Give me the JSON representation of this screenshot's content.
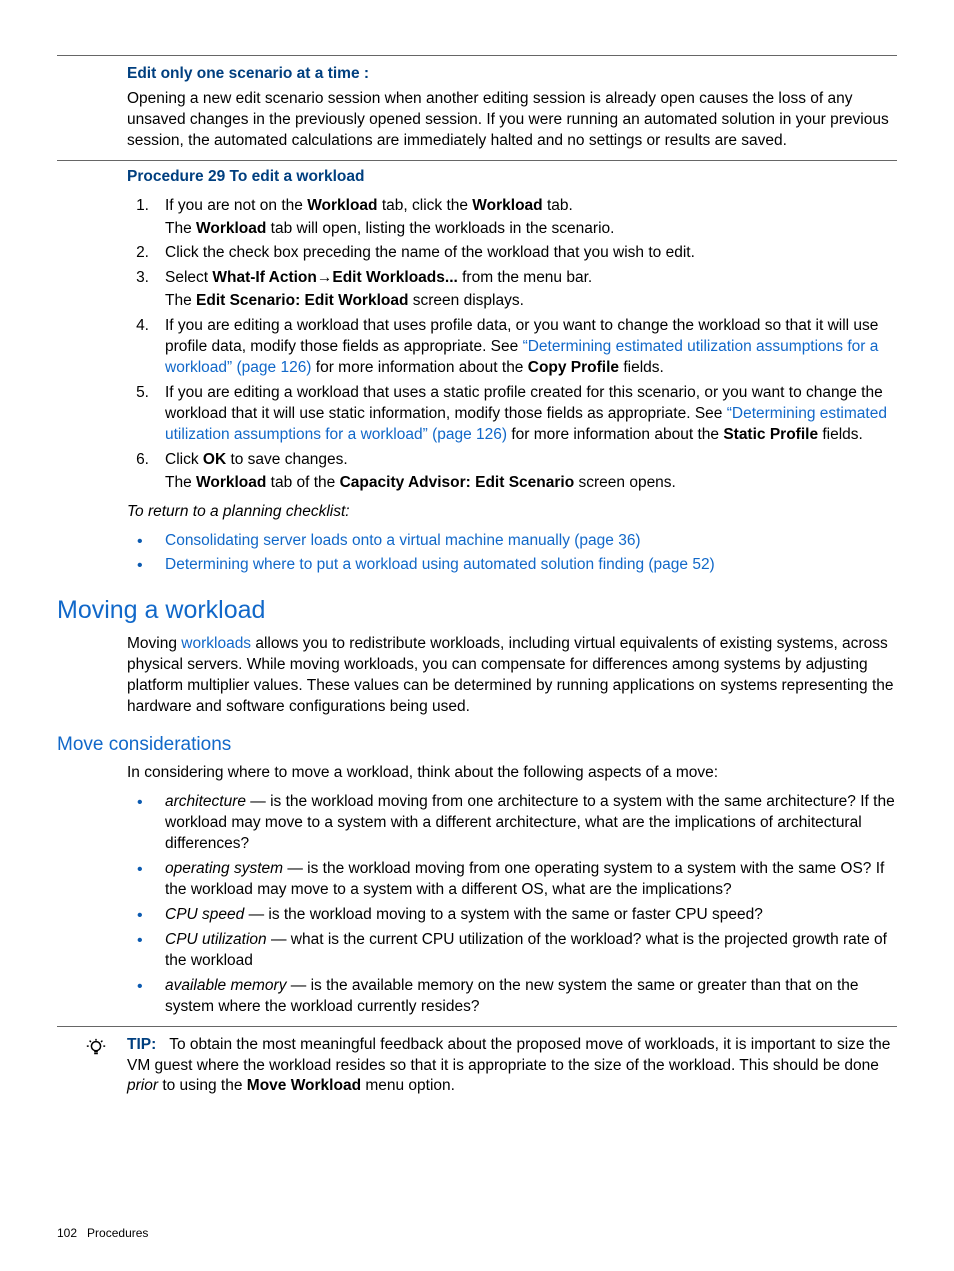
{
  "callout": {
    "title": "Edit only one scenario at a time :",
    "body": "Opening a new edit scenario session when another editing session is already open causes the loss of any unsaved changes in the previously opened session. If you were running an automated solution in your previous session, the automated calculations are immediately halted and no settings or results are saved."
  },
  "procedure": {
    "title": "Procedure 29 To edit a workload",
    "step1_a": "If you are not on the ",
    "step1_b": " tab, click the ",
    "step1_c": " tab.",
    "step1_sub_a": "The ",
    "step1_sub_b": " tab will open, listing the workloads in the scenario.",
    "step2": "Click the check box preceding the name of the workload that you wish to edit.",
    "step3_a": "Select ",
    "step3_b": " from the menu bar.",
    "step3_sub_a": "The ",
    "step3_sub_b": " screen displays.",
    "step4_a": "If you are editing a workload that uses profile data, or you want to change the workload so that it will use profile data, modify those fields as appropriate. See ",
    "step4_link": "“Determining estimated utilization assumptions for a workload” (page 126)",
    "step4_b": " for more information about the ",
    "step4_c": " fields.",
    "step5_a": "If you are editing a workload that uses a static profile created for this scenario, or you want to change the workload that it will use static information, modify those fields as appropriate. See ",
    "step5_link": "“Determining estimated utilization assumptions for a workload” (page 126)",
    "step5_b": " for more information about the ",
    "step5_c": " fields.",
    "step6_a": "Click ",
    "step6_b": "  to save changes.",
    "step6_sub_a": "The ",
    "step6_sub_b": " tab of the ",
    "step6_sub_c": " screen opens.",
    "bold": {
      "workload": "Workload",
      "whatif": "What-If Action",
      "editwl": "Edit Workloads...",
      "editscenario": "Edit Scenario: Edit Workload",
      "copyprofile": "Copy Profile",
      "staticprofile": "Static Profile",
      "ok": "OK",
      "capadvisor": "Capacity Advisor: Edit Scenario"
    }
  },
  "return": {
    "intro": "To return to a planning checklist:",
    "link1": "Consolidating server loads onto a virtual machine manually (page 36)",
    "link2": "Determining where to put a workload using automated solution finding (page 52)"
  },
  "moving": {
    "heading": "Moving a workload",
    "p_a": "Moving ",
    "p_link": "workloads",
    "p_b": " allows you to redistribute workloads, including virtual equivalents of existing systems, across physical servers. While moving workloads, you can compensate for differences among systems by adjusting platform multiplier values. These values can be determined by running applications on systems representing the hardware and software configurations being used."
  },
  "considerations": {
    "heading": "Move considerations",
    "intro": "In considering where to move a workload, think about the following aspects of a move:",
    "i1_term": "architecture",
    "i1_body": " — is the workload moving from one architecture to a system with the same architecture? If the workload may move to a system with a different architecture, what are the implications of architectural differences?",
    "i2_term": "operating system",
    "i2_body": " — is the workload moving from one operating system to a system with the same OS? If the workload may move to a system with a different OS, what are the implications?",
    "i3_term": "CPU speed",
    "i3_body": " — is the workload moving to a system with the same or faster CPU speed?",
    "i4_term": "CPU utilization",
    "i4_body": " — what is the current CPU utilization of the workload? what is the projected growth rate of the workload",
    "i5_term": "available memory",
    "i5_body": " — is the available memory on the new system the same or greater than that on the system where the workload currently resides?"
  },
  "tip": {
    "label": "TIP:",
    "a": "To obtain the most meaningful feedback about the proposed move of workloads, it is important to size the VM guest where the workload resides so that it is appropriate to the size of the workload. This should be done ",
    "prior": "prior",
    "b": " to using the ",
    "bold": "Move Workload",
    "c": " menu option."
  },
  "footer": {
    "page": "102",
    "section": "Procedures"
  },
  "glyph": {
    "arrow": "→"
  }
}
